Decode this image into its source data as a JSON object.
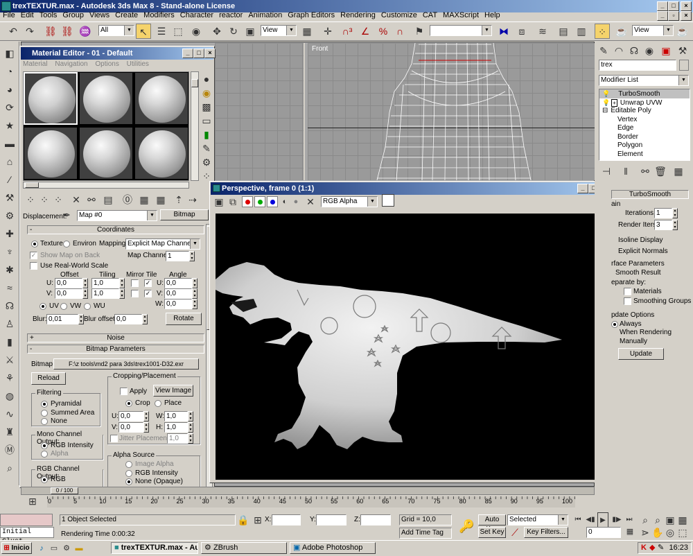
{
  "window": {
    "title": "trexTEXTUR.max - Autodesk 3ds Max 8 - Stand-alone License"
  },
  "menu": [
    "File",
    "Edit",
    "Tools",
    "Group",
    "Views",
    "Create",
    "Modifiers",
    "Character",
    "reactor",
    "Animation",
    "Graph Editors",
    "Rendering",
    "Customize",
    "CAT",
    "MAXScript",
    "Help"
  ],
  "toolbar": {
    "selection_filter": "All",
    "ref_coord": "View",
    "ref_coord2": "View"
  },
  "viewports": {
    "front_label": "Front"
  },
  "material_editor": {
    "title": "Material Editor - 01 - Default",
    "menu": [
      "Material",
      "Navigation",
      "Options",
      "Utilities"
    ],
    "displacement_label": "Displacement:",
    "map_name": "Map #0",
    "map_type": "Bitmap",
    "coordinates": {
      "header": "Coordinates",
      "texture": "Texture",
      "environ": "Environ",
      "mapping_label": "Mapping:",
      "mapping_value": "Explicit Map Channel",
      "show_map_on_back": "Show Map on Back",
      "map_channel_label": "Map Channel:",
      "map_channel": "1",
      "use_real_world": "Use Real-World Scale",
      "offset": "Offset",
      "tiling": "Tiling",
      "mirror_tile": "Mirror Tile",
      "angle": "Angle",
      "u": "U:",
      "v": "V:",
      "w": "W:",
      "u_offset": "0,0",
      "v_offset": "0,0",
      "u_tiling": "1,0",
      "v_tiling": "1,0",
      "u_angle": "0,0",
      "v_angle": "0,0",
      "w_angle": "0,0",
      "uv": "UV",
      "vw": "VW",
      "wu": "WU",
      "blur_label": "Blur:",
      "blur": "0,01",
      "blur_offset_label": "Blur offset:",
      "blur_offset": "0,0",
      "rotate": "Rotate"
    },
    "noise_header": "Noise",
    "bitmap_params": {
      "header": "Bitmap Parameters",
      "bitmap_label": "Bitmap:",
      "bitmap_path": "F:\\z tools\\md2 para 3ds\\trex1001-D32.exr",
      "reload": "Reload",
      "cropping": "Cropping/Placement",
      "apply": "Apply",
      "view_image": "View Image",
      "crop": "Crop",
      "place": "Place",
      "u": "U:",
      "v": "V:",
      "w": "W:",
      "h": "H:",
      "u_val": "0,0",
      "v_val": "0,0",
      "w_val": "1,0",
      "h_val": "1,0",
      "jitter": "Jitter Placement",
      "jitter_val": "1,0",
      "filtering": "Filtering",
      "pyramidal": "Pyramidal",
      "summed_area": "Summed Area",
      "none": "None",
      "mono_output": "Mono Channel Output:",
      "rgb_intensity": "RGB Intensity",
      "alpha": "Alpha",
      "rgb_output": "RGB Channel Output:",
      "rgb": "RGB",
      "alpha_source": "Alpha Source",
      "image_alpha": "Image Alpha",
      "rgb_intensity2": "RGB Intensity",
      "none_opaque": "None (Opaque)"
    }
  },
  "render_window": {
    "title": "Perspective, frame 0 (1:1)",
    "channel": "RGB Alpha"
  },
  "command_panel": {
    "object_name": "trex",
    "modifier_list": "Modifier List",
    "stack": [
      "TurboSmooth",
      "Unwrap UVW",
      "Editable Poly",
      "Vertex",
      "Edge",
      "Border",
      "Polygon",
      "Element"
    ],
    "turbosmooth_header": "TurboSmooth",
    "main": "ain",
    "iterations_label": "Iterations:",
    "iterations": "1",
    "render_iters_label": "Render Iters:",
    "render_iters": "3",
    "isoline": "Isoline Display",
    "explicit_normals": "Explicit Normals",
    "surface_params": "rface Parameters",
    "smooth_result": "Smooth Result",
    "separate_by": "eparate by:",
    "materials": "Materials",
    "smoothing_groups": "Smoothing Groups",
    "update_options": "pdate Options",
    "always": "Always",
    "when_rendering": "When Rendering",
    "manually": "Manually",
    "update": "Update"
  },
  "timeline": {
    "slider": "0 / 100",
    "ticks": [
      "0",
      "5",
      "10",
      "15",
      "20",
      "25",
      "30",
      "35",
      "40",
      "45",
      "50",
      "55",
      "60",
      "65",
      "70",
      "75",
      "80",
      "85",
      "90",
      "95",
      "100"
    ]
  },
  "status": {
    "objects_selected": "1 Object Selected",
    "rendering_time": "Rendering Time  0:00:32",
    "x": "X:",
    "y": "Y:",
    "z": "Z:",
    "grid": "Grid = 10,0",
    "add_time_tag": "Add Time Tag",
    "auto_key": "Auto Key",
    "set_key": "Set Key",
    "selected": "Selected",
    "key_filters": "Key Filters...",
    "frame": "0",
    "listener": "Initial Clust"
  },
  "taskbar": {
    "start": "Inicio",
    "items": [
      "trexTEXTUR.max - Au...",
      "ZBrush",
      "Adobe Photoshop"
    ],
    "clock": "16:23"
  }
}
